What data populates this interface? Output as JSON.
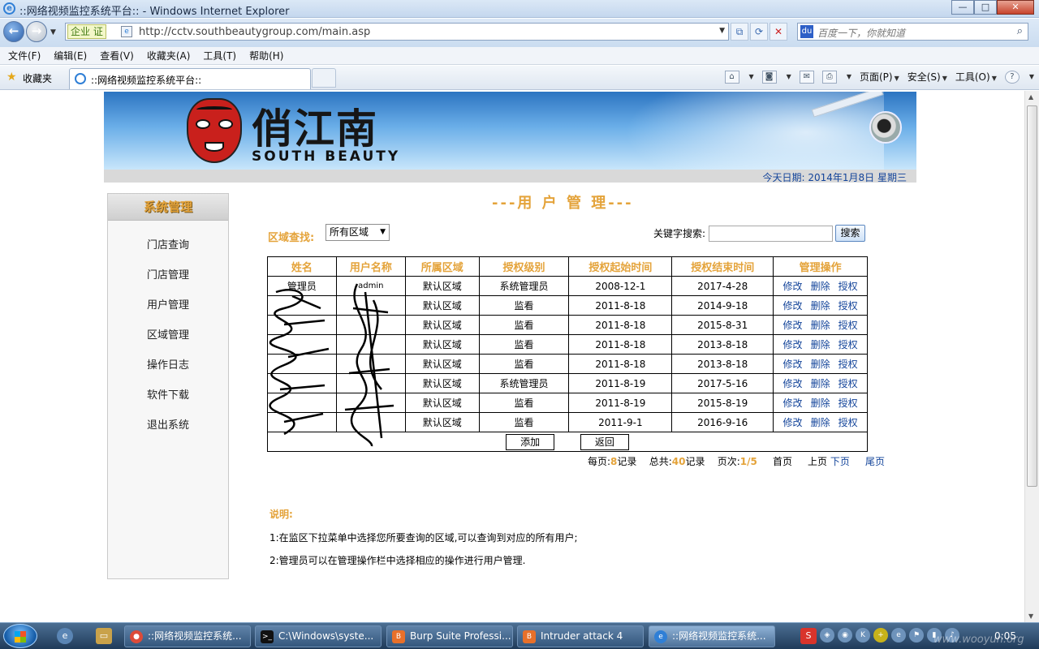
{
  "window": {
    "title": "::网络视频监控系统平台:: - Windows Internet Explorer",
    "controls": [
      "—",
      "□",
      "✕"
    ]
  },
  "address_bar": {
    "cert_badge": "企业 证",
    "url": "http://cctv.southbeautygroup.com/main.asp",
    "search_placeholder": "百度一下，你就知道"
  },
  "menu": [
    "文件(F)",
    "编辑(E)",
    "查看(V)",
    "收藏夹(A)",
    "工具(T)",
    "帮助(H)"
  ],
  "favorites": {
    "label": "收藏夹",
    "tab_title": "::网络视频监控系统平台::"
  },
  "command_bar": [
    "页面(P)",
    "安全(S)",
    "工具(O)"
  ],
  "banner": {
    "logo_cn": "俏江南",
    "logo_en": "SOUTH BEAUTY",
    "date": "今天日期: 2014年1月8日 星期三"
  },
  "sidebar": {
    "title": "系统管理",
    "items": [
      "门店查询",
      "门店管理",
      "用户管理",
      "区域管理",
      "操作日志",
      "软件下载",
      "退出系统"
    ]
  },
  "page": {
    "title": "---用 户 管 理---",
    "filter_label": "区域查找:",
    "region_selected": "所有区域",
    "keyword_label": "关键字搜索:",
    "search_button": "搜索"
  },
  "table": {
    "headers": [
      "姓名",
      "用户名称",
      "所属区域",
      "授权级别",
      "授权起始时间",
      "授权结束时间",
      "管理操作"
    ],
    "actions": [
      "修改",
      "删除",
      "授权"
    ],
    "rows": [
      {
        "name": "管理员",
        "user": "admin",
        "region": "默认区域",
        "level": "系统管理员",
        "start": "2008-12-1",
        "end": "2017-4-28"
      },
      {
        "name": "",
        "user": "",
        "region": "默认区域",
        "level": "监看",
        "start": "2011-8-18",
        "end": "2014-9-18"
      },
      {
        "name": "",
        "user": "",
        "region": "默认区域",
        "level": "监看",
        "start": "2011-8-18",
        "end": "2015-8-31"
      },
      {
        "name": "",
        "user": "",
        "region": "默认区域",
        "level": "监看",
        "start": "2011-8-18",
        "end": "2013-8-18"
      },
      {
        "name": "",
        "user": "",
        "region": "默认区域",
        "level": "监看",
        "start": "2011-8-18",
        "end": "2013-8-18"
      },
      {
        "name": "",
        "user": "",
        "region": "默认区域",
        "level": "系统管理员",
        "start": "2011-8-19",
        "end": "2017-5-16"
      },
      {
        "name": "",
        "user": "",
        "region": "默认区域",
        "level": "监看",
        "start": "2011-8-19",
        "end": "2015-8-19"
      },
      {
        "name": "",
        "user": "",
        "region": "默认区域",
        "level": "监看",
        "start": "2011-9-1",
        "end": "2016-9-16"
      }
    ],
    "add_button": "添加",
    "back_button": "返回"
  },
  "pager": {
    "per_page_label": "每页:",
    "per_page": "8",
    "records_label": "记录",
    "total_label": "总共:",
    "total": "40",
    "page_label": "页次:",
    "current": "1",
    "sep": "/",
    "pages": "5",
    "first": "首页",
    "prev": "上页",
    "next": "下页",
    "last": "尾页"
  },
  "notes": {
    "title": "说明:",
    "lines": [
      "1:在监区下拉菜单中选择您所要查询的区域,可以查询到对应的所有用户;",
      "2:管理员可以在管理操作栏中选择相应的操作进行用户管理."
    ]
  },
  "taskbar": {
    "tasks": [
      "::网络视频监控系统...",
      "C:\\Windows\\syste...",
      "Burp Suite Professi...",
      "Intruder attack 4",
      "::网络视频监控系统..."
    ],
    "clock": "0:05",
    "watermark": "www.wooyun.org"
  },
  "colors": {
    "accent_orange": "#e4a33a",
    "link_blue": "#13449a"
  }
}
